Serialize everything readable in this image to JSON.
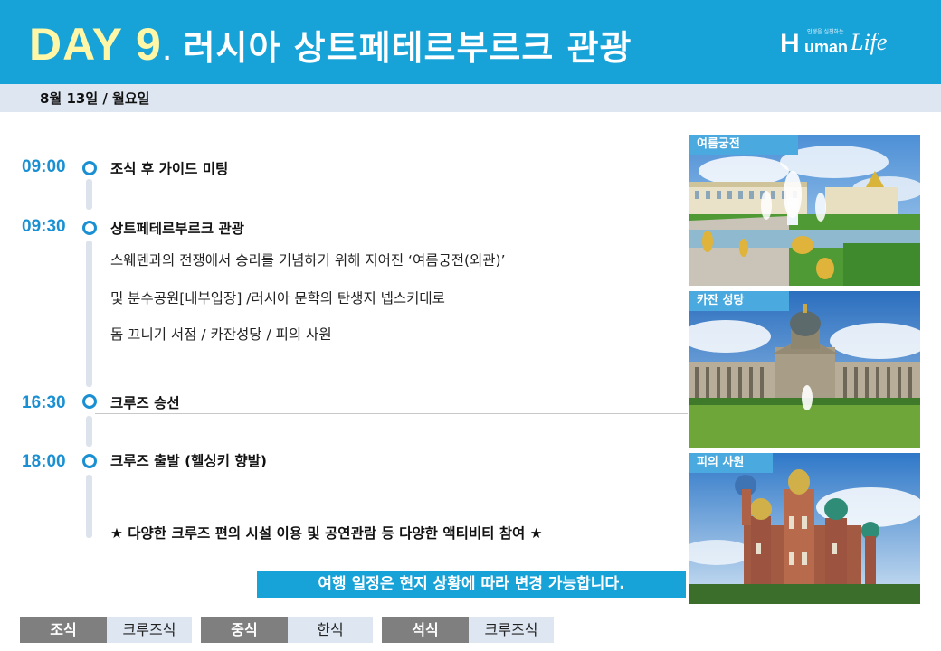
{
  "header": {
    "day": "DAY 9",
    "dot": ".",
    "title": "러시아 상트페테르부르크 관광",
    "logo": {
      "h": "H",
      "uman": "uman",
      "life": "Life",
      "tagline": "인생을 실천하는"
    }
  },
  "date": "8월 13일 / 월요일",
  "schedule": [
    {
      "time": "09:00",
      "title": "조식 후 가이드 미팅",
      "details": []
    },
    {
      "time": "09:30",
      "title": "상트페테르부르크 관광",
      "details": [
        "스웨덴과의 전쟁에서 승리를 기념하기 위해 지어진 ‘여름궁전(외관)’",
        "및 분수공원[내부입장] /러시아 문학의 탄생지 넵스키대로",
        "돔 끄니기 서점 / 카잔성당 / 피의 사원"
      ]
    },
    {
      "time": "16:30",
      "title": "크루즈 승선",
      "details": []
    },
    {
      "time": "18:00",
      "title": "크루즈 출발 (헬싱키 향발)",
      "details": []
    }
  ],
  "highlight": "★ 다양한 크루즈 편의 시설 이용 및 공연관람 등 다양한 액티비티 참여 ★",
  "notice": "여행 일정은 현지 상황에 따라 변경 가능합니다.",
  "photos": [
    {
      "label": "여름궁전",
      "icon": "summer-palace-photo"
    },
    {
      "label": "카잔 성당",
      "icon": "kazan-cathedral-photo"
    },
    {
      "label": "피의 사원",
      "icon": "church-of-savior-on-blood-photo"
    }
  ],
  "meals": [
    {
      "type": "조식",
      "value": "크루즈식"
    },
    {
      "type": "중식",
      "value": "한식"
    },
    {
      "type": "석식",
      "value": "크루즈식"
    }
  ],
  "colors": {
    "header_bg": "#17a2d8",
    "day_text": "#fff7a8",
    "accent_blue": "#1a90d3",
    "date_bar": "#dde6f1",
    "meal_label_bg": "#7f7f7f"
  }
}
